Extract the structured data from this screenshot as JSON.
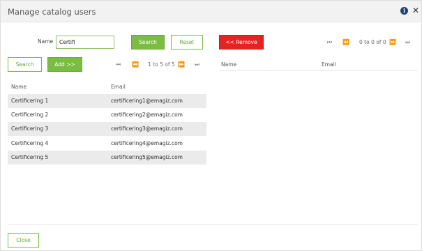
{
  "dialog": {
    "title": "Manage catalog users",
    "info_icon": "info-icon",
    "close_icon": "close-icon"
  },
  "filter": {
    "name_label": "Name",
    "name_value": "Certifi",
    "search_label": "Search",
    "reset_label": "Reset"
  },
  "actions": {
    "remove_label": "<< Remove",
    "search_label": "Search",
    "add_label": "Add >>"
  },
  "left_table": {
    "pager_text": "1 to 5 of 5",
    "columns": [
      "Name",
      "Email"
    ],
    "rows": [
      {
        "name": "Certificering 1",
        "email": "certificering1@emagiz.com"
      },
      {
        "name": "Certificering 2",
        "email": "certificering2@emagiz.com"
      },
      {
        "name": "Certificering 3",
        "email": "certificering3@emagiz.com"
      },
      {
        "name": "Certificering 4",
        "email": "certificering4@emagiz.com"
      },
      {
        "name": "Certificering 5",
        "email": "certificering5@emagiz.com"
      }
    ]
  },
  "right_table": {
    "pager_text": "0 to 0 of 0",
    "columns": [
      "Name",
      "Email"
    ]
  },
  "footer": {
    "close_label": "Close"
  },
  "colors": {
    "accent_green": "#7bbd42",
    "danger_red": "#e52322",
    "info_blue": "#1f3f73"
  }
}
